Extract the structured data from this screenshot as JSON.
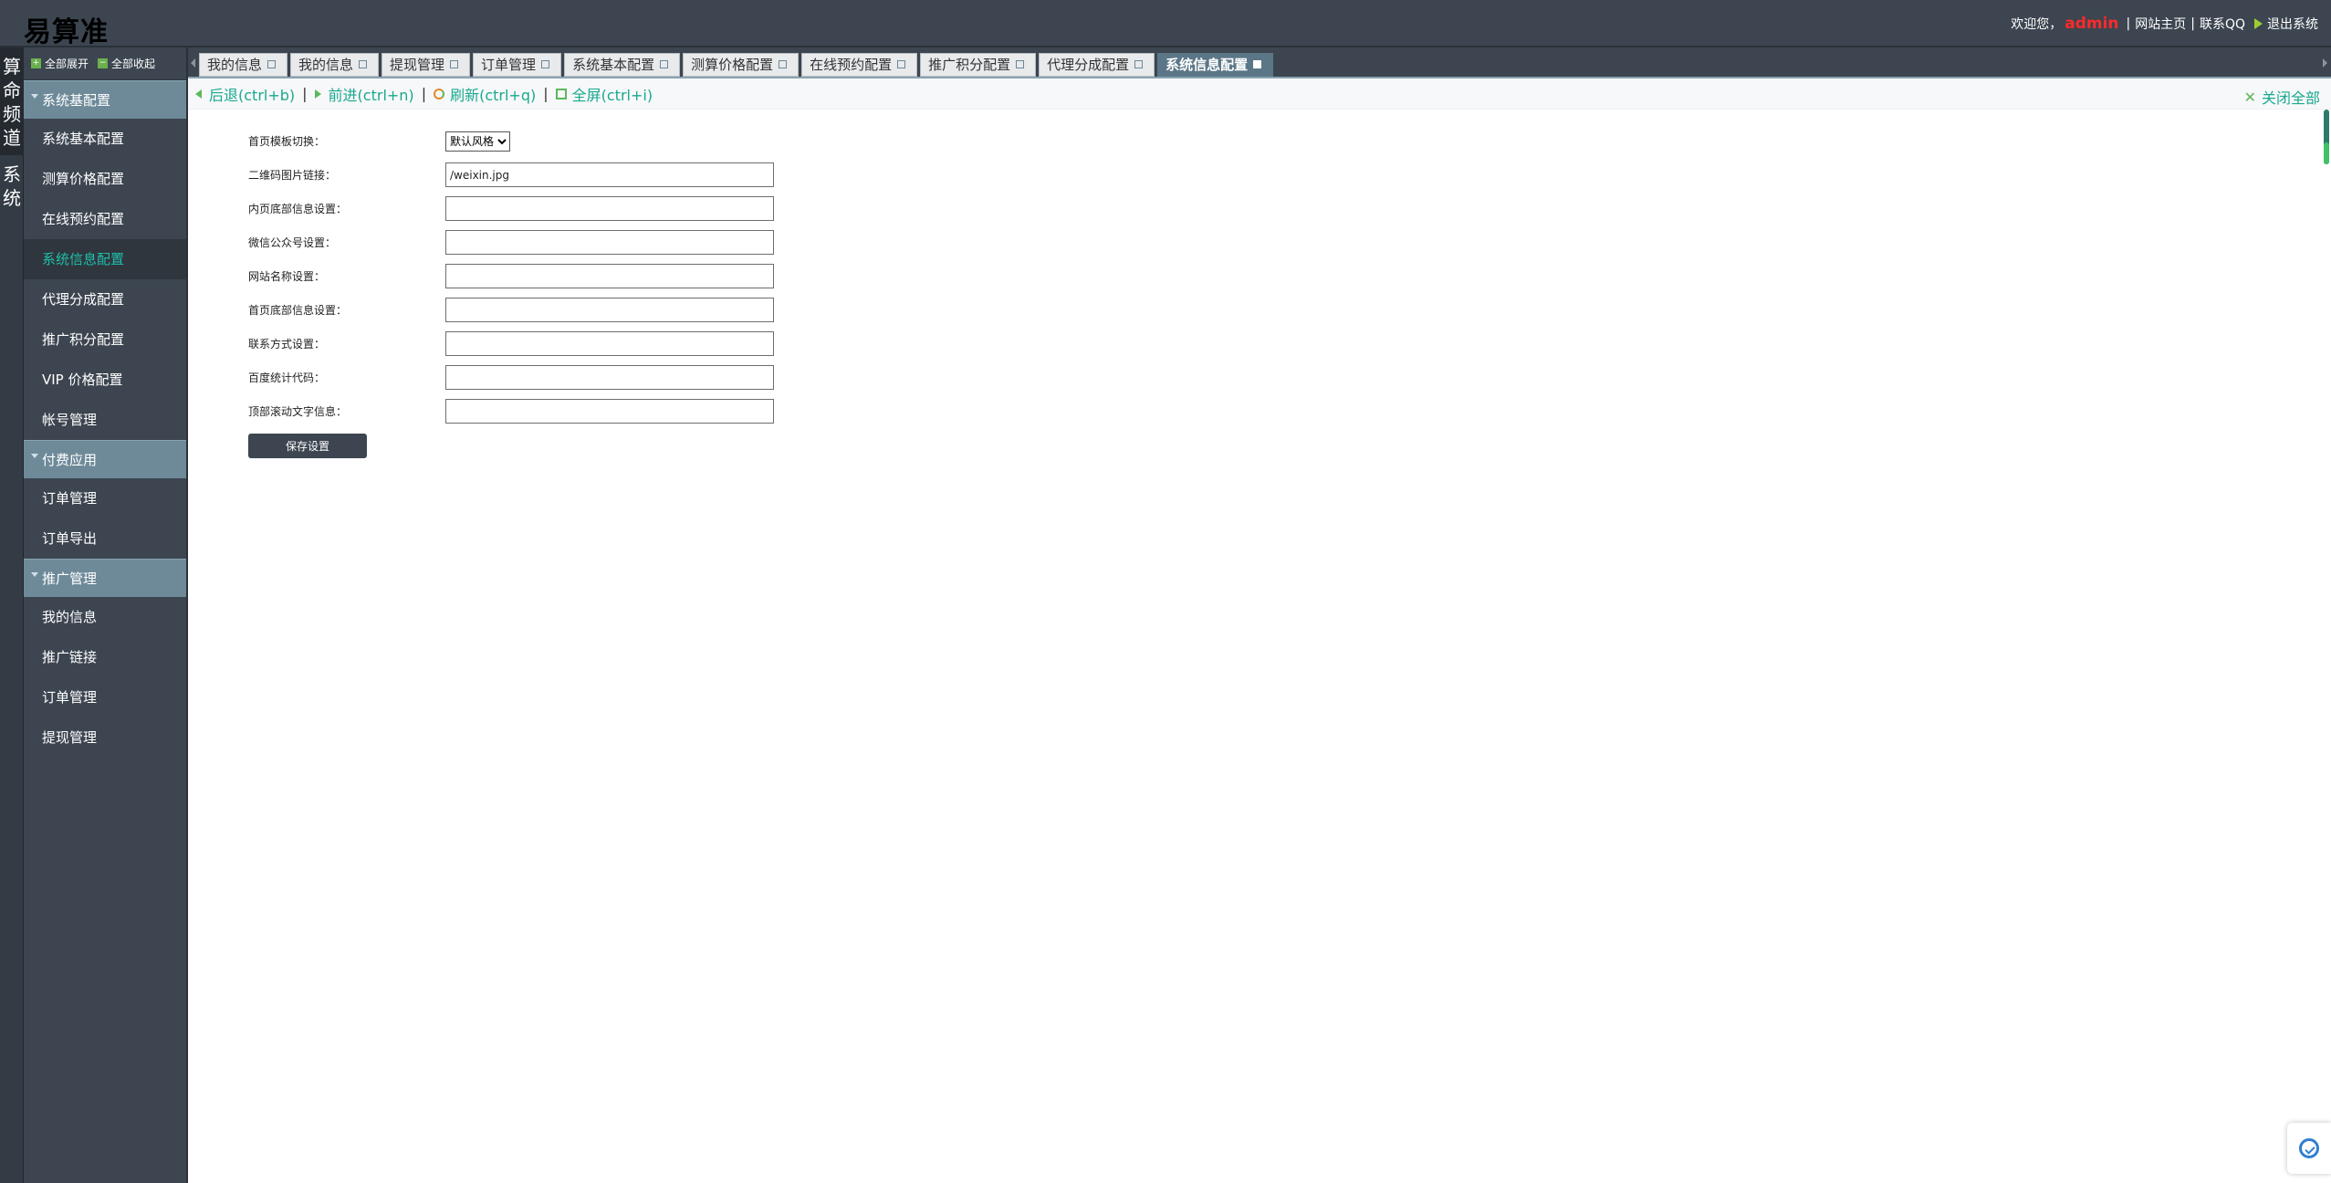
{
  "app": {
    "title": "易算准"
  },
  "header": {
    "welcome": "欢迎您，",
    "username": "admin",
    "links": [
      "网站主页",
      "联系QQ"
    ],
    "logout": "退出系统"
  },
  "channels": [
    {
      "label": "算命频道",
      "active": true
    },
    {
      "label": "系统",
      "active": false
    }
  ],
  "sidebar": {
    "expand_all": "全部展开",
    "collapse_all": "全部收起",
    "groups": [
      {
        "title": "系统基配置",
        "items": [
          {
            "label": "系统基本配置"
          },
          {
            "label": "测算价格配置"
          },
          {
            "label": "在线预约配置"
          },
          {
            "label": "系统信息配置",
            "active": true
          },
          {
            "label": "代理分成配置"
          },
          {
            "label": "推广积分配置"
          },
          {
            "label": "VIP 价格配置"
          },
          {
            "label": "帐号管理"
          }
        ]
      },
      {
        "title": "付费应用",
        "items": [
          {
            "label": "订单管理"
          },
          {
            "label": "订单导出"
          }
        ]
      },
      {
        "title": "推广管理",
        "items": [
          {
            "label": "我的信息"
          },
          {
            "label": "推广链接"
          },
          {
            "label": "订单管理"
          },
          {
            "label": "提现管理"
          }
        ]
      }
    ]
  },
  "tabs": [
    {
      "label": "我的信息"
    },
    {
      "label": "我的信息"
    },
    {
      "label": "提现管理"
    },
    {
      "label": "订单管理"
    },
    {
      "label": "系统基本配置"
    },
    {
      "label": "测算价格配置"
    },
    {
      "label": "在线预约配置"
    },
    {
      "label": "推广积分配置"
    },
    {
      "label": "代理分成配置"
    },
    {
      "label": "系统信息配置",
      "active": true
    }
  ],
  "toolbar": {
    "back": "后退(ctrl+b)",
    "forward": "前进(ctrl+n)",
    "refresh": "刷新(ctrl+q)",
    "fullscreen": "全屏(ctrl+i)",
    "close_all": "关闭全部"
  },
  "form": {
    "theme_label": "首页模板切换：",
    "theme_selected": "默认风格",
    "fields": [
      {
        "label": "二维码图片链接：",
        "value": "/weixin.jpg"
      },
      {
        "label": "内页底部信息设置：",
        "value": ""
      },
      {
        "label": "微信公众号设置：",
        "value": ""
      },
      {
        "label": "网站名称设置：",
        "value": ""
      },
      {
        "label": "首页底部信息设置：",
        "value": ""
      },
      {
        "label": "联系方式设置：",
        "value": ""
      },
      {
        "label": "百度统计代码：",
        "value": ""
      },
      {
        "label": "顶部滚动文字信息：",
        "value": ""
      }
    ],
    "save_label": "保存设置"
  },
  "colors": {
    "chrome": "#3c4550",
    "group_header": "#6e8a99",
    "active_tab": "#5b7687",
    "accent_link": "#1aa88f",
    "username": "#ff2a2a"
  }
}
